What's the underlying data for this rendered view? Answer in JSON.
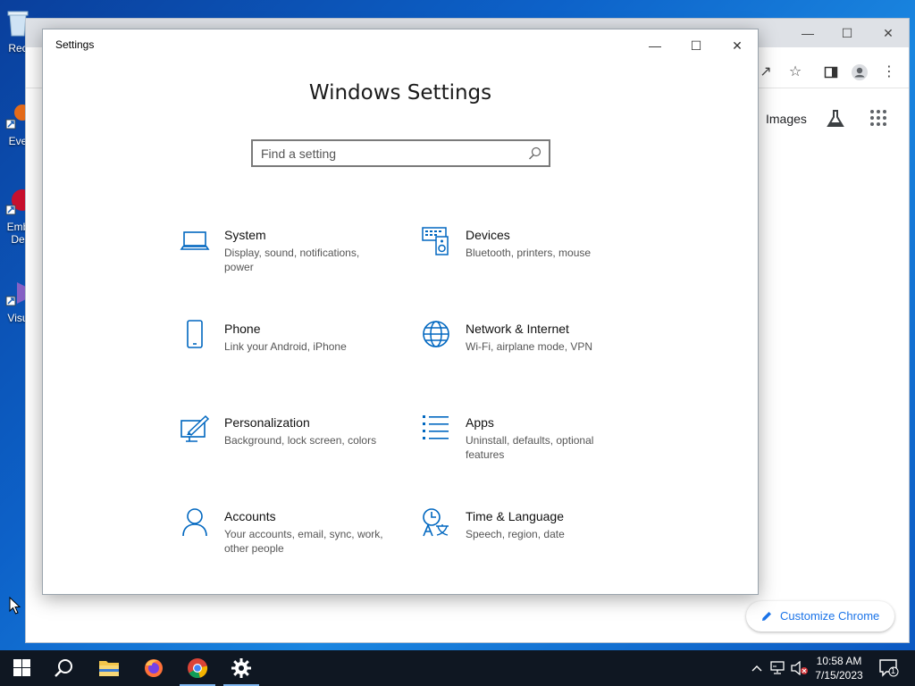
{
  "desktop": {
    "icons": [
      {
        "label": "Rec",
        "icon": "recycle-bin-icon"
      },
      {
        "label": "Eve",
        "icon": "app-shortcut-icon"
      },
      {
        "label": "Emb",
        "label2": "De",
        "icon": "app-shortcut-icon"
      },
      {
        "label": "Visu",
        "icon": "visual-studio-icon"
      }
    ]
  },
  "chrome": {
    "images_link": "Images",
    "customize_label": "Customize Chrome"
  },
  "settings": {
    "window_title": "Settings",
    "heading": "Windows Settings",
    "search_placeholder": "Find a setting",
    "tiles": [
      {
        "name": "System",
        "desc": "Display, sound, notifications, power",
        "icon": "laptop-icon"
      },
      {
        "name": "Devices",
        "desc": "Bluetooth, printers, mouse",
        "icon": "keyboard-speaker-icon"
      },
      {
        "name": "Phone",
        "desc": "Link your Android, iPhone",
        "icon": "phone-icon"
      },
      {
        "name": "Network & Internet",
        "desc": "Wi-Fi, airplane mode, VPN",
        "icon": "globe-icon"
      },
      {
        "name": "Personalization",
        "desc": "Background, lock screen, colors",
        "icon": "paintbrush-monitor-icon"
      },
      {
        "name": "Apps",
        "desc": "Uninstall, defaults, optional features",
        "icon": "app-list-icon"
      },
      {
        "name": "Accounts",
        "desc": "Your accounts, email, sync, work, other people",
        "icon": "person-icon"
      },
      {
        "name": "Time & Language",
        "desc": "Speech, region, date",
        "icon": "clock-language-icon"
      }
    ]
  },
  "taskbar": {
    "time": "10:58 AM",
    "date": "7/15/2023",
    "notification_count": "1"
  },
  "colors": {
    "accent": "#0067c0",
    "taskbar": "#0f1722"
  }
}
